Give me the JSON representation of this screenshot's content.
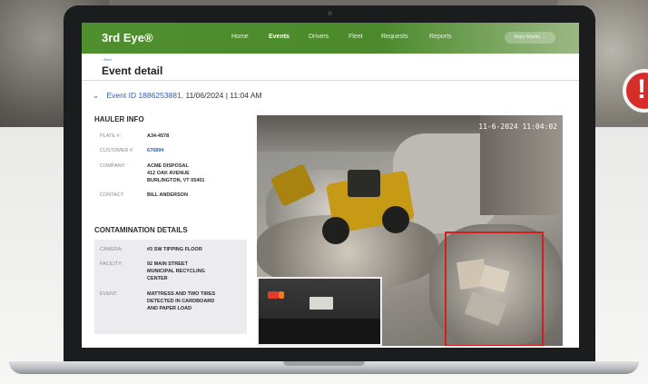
{
  "nav": {
    "brand": "3rd Eye®",
    "links": [
      "Home",
      "Events",
      "Drivers",
      "Fleet",
      "Requests",
      "Reports"
    ],
    "active_link": "Events",
    "user": "Mary Martin ⌄"
  },
  "page": {
    "back": "‹ Back",
    "title": "Event detail"
  },
  "event": {
    "chevron": "⌄",
    "id": "Event ID 1886253881,",
    "date_time": "11/06/2024 | 11:04 AM"
  },
  "hauler_info": {
    "title": "HAULER INFO",
    "plate_label": "PLATE #:",
    "plate_value": "A34-4578",
    "customer_label": "CUSTOMER #:",
    "customer_value": "676894",
    "company_label": "COMPANY:",
    "company_lines": [
      "ACME DISPOSAL",
      "412 OAK AVENUE",
      "BURLINGTON, VT 05401"
    ],
    "contact_label": "CONTACT",
    "contact_value": "BILL ANDERSON"
  },
  "contamination": {
    "title": "CONTAMINATION DETAILS",
    "camera_label": "CAMERA:",
    "camera_value": "#3 SW TIPPING FLOOR",
    "facility_label": "FACILITY:",
    "facility_lines": [
      "92 MAIN STREET",
      "MUNICIPAL RECYCLING",
      "CENTER"
    ],
    "event_label": "EVENT:",
    "event_lines": [
      "MATTRESS AND TWO TIRES",
      "DETECTED IN CARDBOARD",
      "AND PAPER LOAD"
    ]
  },
  "camera_feed": {
    "timestamp": "11-6-2024 11:04:02"
  },
  "colors": {
    "nav_green": "#4f8f2e",
    "link_blue": "#2e5fa8",
    "alert_red": "#d41f1f"
  }
}
